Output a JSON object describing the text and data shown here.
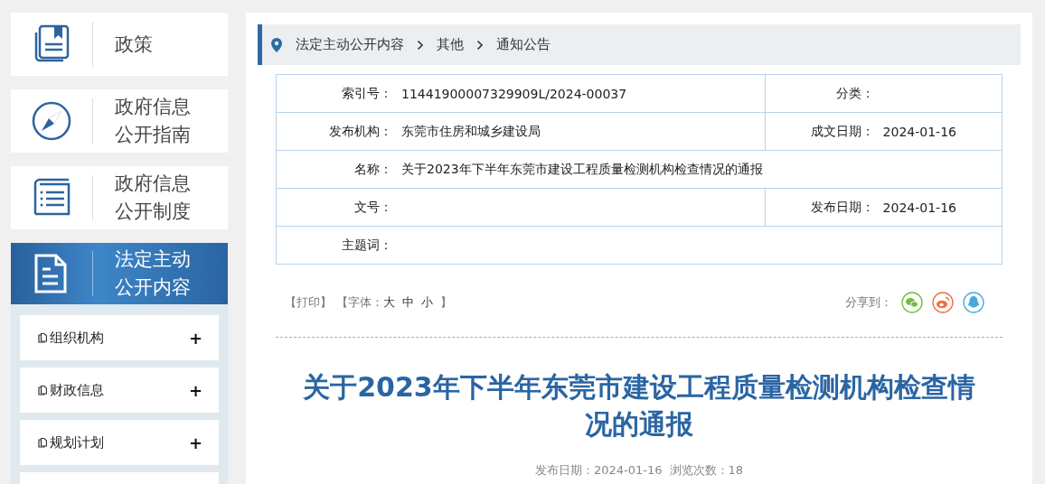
{
  "sidebar": {
    "items": [
      {
        "label": "政策",
        "kind": "book",
        "selected": false
      },
      {
        "label": "政府信息公开指南",
        "kind": "compass",
        "selected": false
      },
      {
        "label": "政府信息公开制度",
        "kind": "list",
        "selected": false
      },
      {
        "label": "法定主动公开内容",
        "kind": "document",
        "selected": true
      }
    ],
    "subitems": [
      {
        "label": "组织机构",
        "toggle": "+"
      },
      {
        "label": "财政信息",
        "toggle": "+"
      },
      {
        "label": "规划计划",
        "toggle": "+"
      }
    ]
  },
  "breadcrumb": [
    "法定主动公开内容",
    "其他",
    "通知公告"
  ],
  "meta_table": {
    "rows": [
      [
        {
          "label": "索引号：",
          "value": "11441900007329909L/2024-00037"
        },
        {
          "label": "分类："
        }
      ],
      [
        {
          "label": "发布机构：",
          "value": "东莞市住房和城乡建设局"
        },
        {
          "label": "成文日期：",
          "value": "2024-01-16"
        }
      ],
      [
        {
          "label": "名称：",
          "value": "关于2023年下半年东莞市建设工程质量检测机构检查情况的通报"
        }
      ],
      [
        {
          "label": "文号："
        },
        {
          "label": "发布日期：",
          "value": "2024-01-16"
        }
      ],
      [
        {
          "label": "主题词："
        }
      ]
    ]
  },
  "toolbar": {
    "print": "【打印】",
    "font_label": "【字体：",
    "font_sizes": [
      "大",
      "中",
      "小"
    ],
    "font_end": "】",
    "share_label": "分享到：",
    "share": [
      {
        "kind": "wechat",
        "color": "#6cbf3f"
      },
      {
        "kind": "weibo",
        "color": "#f26d3d"
      },
      {
        "kind": "qq",
        "color": "#4aa8e0"
      }
    ]
  },
  "article": {
    "title": "关于2023年下半年东莞市建设工程质量检测机构检查情况的通报",
    "publish_date": "发布日期：2024-01-16",
    "views": "浏览次数：18"
  }
}
